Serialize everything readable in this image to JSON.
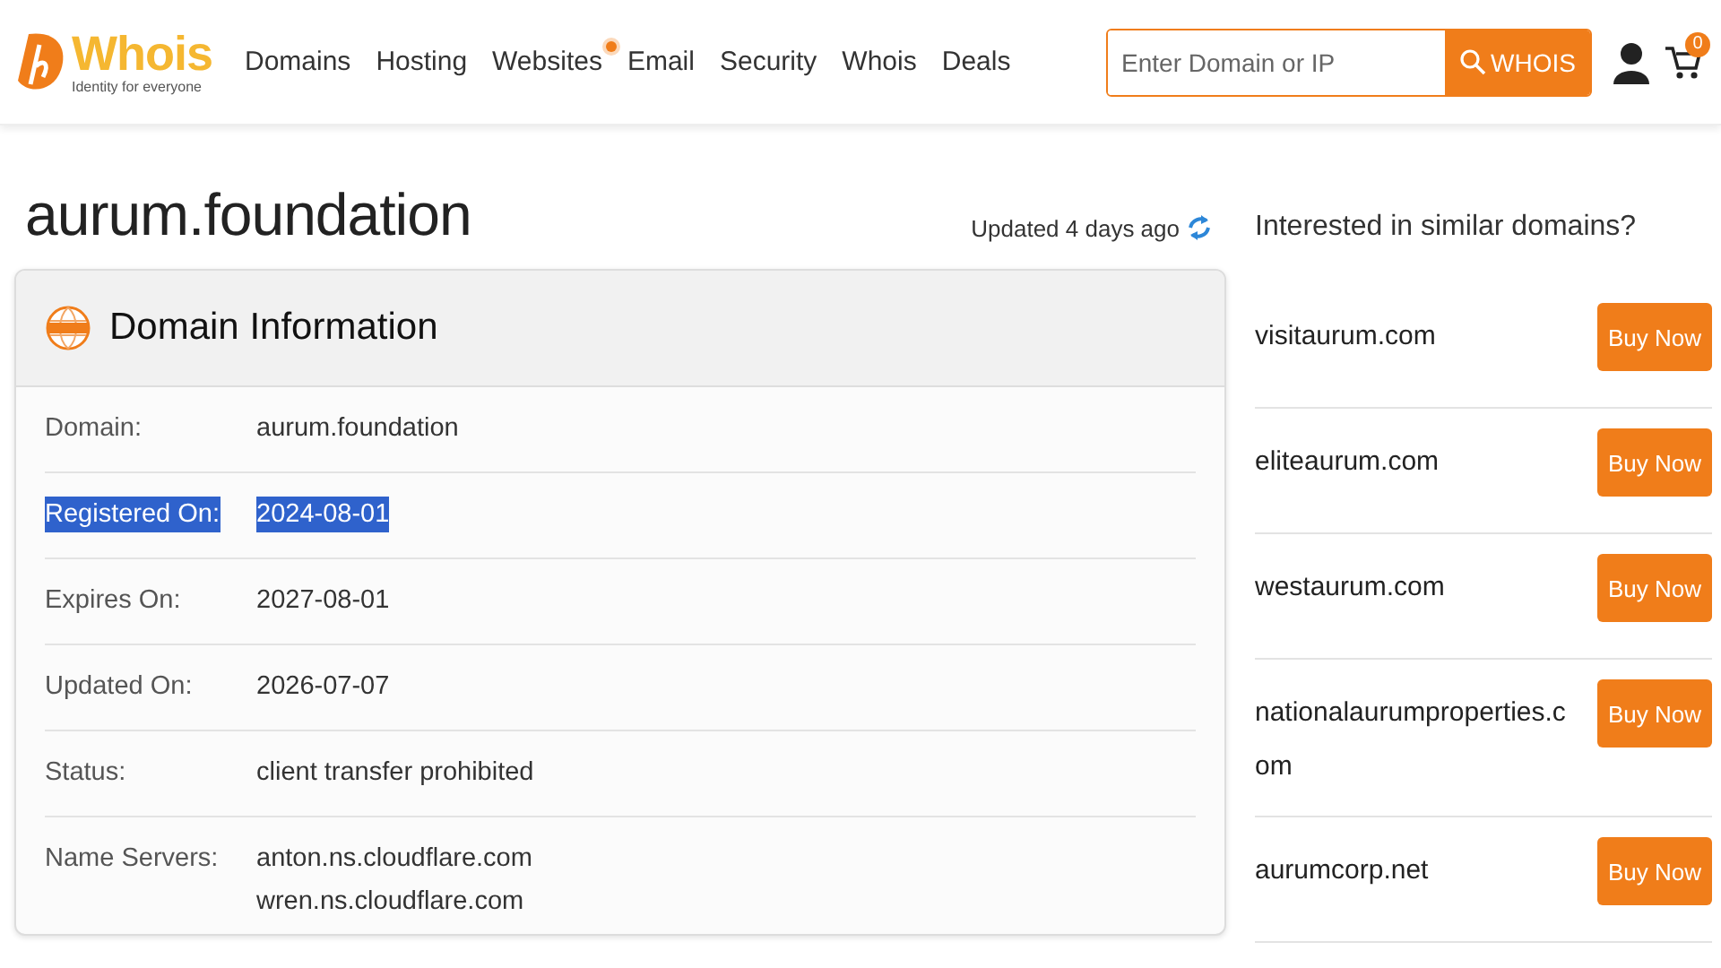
{
  "header": {
    "logo": {
      "name": "Whois",
      "tagline": "Identity for everyone"
    },
    "nav": [
      {
        "label": "Domains",
        "dot": false
      },
      {
        "label": "Hosting",
        "dot": false
      },
      {
        "label": "Websites",
        "dot": true
      },
      {
        "label": "Email",
        "dot": false
      },
      {
        "label": "Security",
        "dot": false
      },
      {
        "label": "Whois",
        "dot": false
      },
      {
        "label": "Deals",
        "dot": false
      }
    ],
    "search": {
      "placeholder": "Enter Domain or IP",
      "button": "WHOIS"
    },
    "cart_count": "0"
  },
  "title": "aurum.foundation",
  "updated": "Updated 4 days ago",
  "card": {
    "title": "Domain Information",
    "rows": [
      {
        "label": "Domain:",
        "values": [
          "aurum.foundation"
        ],
        "selected": false
      },
      {
        "label": "Registered On:",
        "values": [
          "2024-08-01"
        ],
        "selected": true
      },
      {
        "label": "Expires On:",
        "values": [
          "2027-08-01"
        ],
        "selected": false
      },
      {
        "label": "Updated On:",
        "values": [
          "2026-07-07"
        ],
        "selected": false
      },
      {
        "label": "Status:",
        "values": [
          "client transfer prohibited"
        ],
        "selected": false
      },
      {
        "label": "Name Servers:",
        "values": [
          "anton.ns.cloudflare.com",
          "wren.ns.cloudflare.com"
        ],
        "selected": false
      }
    ]
  },
  "similar": {
    "heading": "Interested in similar domains?",
    "items": [
      {
        "domain": "visitaurum.com",
        "button": "Buy Now"
      },
      {
        "domain": "eliteaurum.com",
        "button": "Buy Now"
      },
      {
        "domain": "westaurum.com",
        "button": "Buy Now"
      },
      {
        "domain": "nationalaurumproperties.com",
        "button": "Buy Now"
      },
      {
        "domain": "aurumcorp.net",
        "button": "Buy Now"
      }
    ]
  }
}
